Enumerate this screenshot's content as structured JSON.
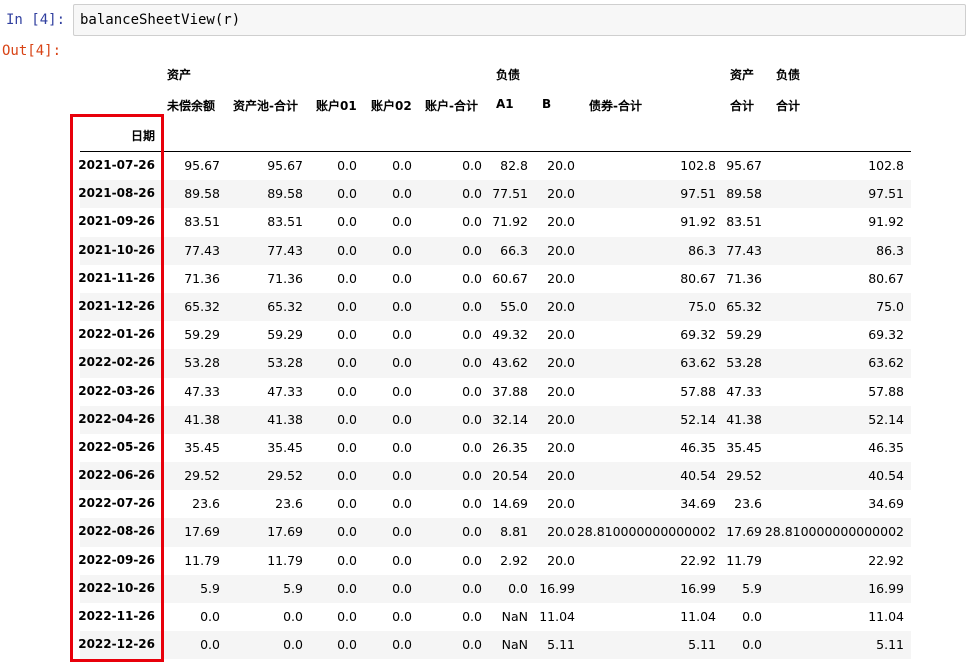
{
  "cell": {
    "in_prompt": "In [4]:",
    "code": "balanceSheetView(r)",
    "out_prompt": "Out[4]:"
  },
  "table": {
    "header_top": [
      "资产",
      "",
      "",
      "",
      "",
      "负债",
      "",
      "",
      "资产",
      "负债"
    ],
    "header_sub": [
      "未偿余额",
      "资产池-合计",
      "账户01",
      "账户02",
      "账户-合计",
      "A1",
      "B",
      "债券-合计",
      "合计",
      "合计"
    ],
    "index_name": "日期",
    "rows": [
      [
        "2021-07-26",
        "95.67",
        "95.67",
        "0.0",
        "0.0",
        "0.0",
        "82.8",
        "20.0",
        "102.8",
        "95.67",
        "102.8"
      ],
      [
        "2021-08-26",
        "89.58",
        "89.58",
        "0.0",
        "0.0",
        "0.0",
        "77.51",
        "20.0",
        "97.51",
        "89.58",
        "97.51"
      ],
      [
        "2021-09-26",
        "83.51",
        "83.51",
        "0.0",
        "0.0",
        "0.0",
        "71.92",
        "20.0",
        "91.92",
        "83.51",
        "91.92"
      ],
      [
        "2021-10-26",
        "77.43",
        "77.43",
        "0.0",
        "0.0",
        "0.0",
        "66.3",
        "20.0",
        "86.3",
        "77.43",
        "86.3"
      ],
      [
        "2021-11-26",
        "71.36",
        "71.36",
        "0.0",
        "0.0",
        "0.0",
        "60.67",
        "20.0",
        "80.67",
        "71.36",
        "80.67"
      ],
      [
        "2021-12-26",
        "65.32",
        "65.32",
        "0.0",
        "0.0",
        "0.0",
        "55.0",
        "20.0",
        "75.0",
        "65.32",
        "75.0"
      ],
      [
        "2022-01-26",
        "59.29",
        "59.29",
        "0.0",
        "0.0",
        "0.0",
        "49.32",
        "20.0",
        "69.32",
        "59.29",
        "69.32"
      ],
      [
        "2022-02-26",
        "53.28",
        "53.28",
        "0.0",
        "0.0",
        "0.0",
        "43.62",
        "20.0",
        "63.62",
        "53.28",
        "63.62"
      ],
      [
        "2022-03-26",
        "47.33",
        "47.33",
        "0.0",
        "0.0",
        "0.0",
        "37.88",
        "20.0",
        "57.88",
        "47.33",
        "57.88"
      ],
      [
        "2022-04-26",
        "41.38",
        "41.38",
        "0.0",
        "0.0",
        "0.0",
        "32.14",
        "20.0",
        "52.14",
        "41.38",
        "52.14"
      ],
      [
        "2022-05-26",
        "35.45",
        "35.45",
        "0.0",
        "0.0",
        "0.0",
        "26.35",
        "20.0",
        "46.35",
        "35.45",
        "46.35"
      ],
      [
        "2022-06-26",
        "29.52",
        "29.52",
        "0.0",
        "0.0",
        "0.0",
        "20.54",
        "20.0",
        "40.54",
        "29.52",
        "40.54"
      ],
      [
        "2022-07-26",
        "23.6",
        "23.6",
        "0.0",
        "0.0",
        "0.0",
        "14.69",
        "20.0",
        "34.69",
        "23.6",
        "34.69"
      ],
      [
        "2022-08-26",
        "17.69",
        "17.69",
        "0.0",
        "0.0",
        "0.0",
        "8.81",
        "20.0",
        "28.810000000000002",
        "17.69",
        "28.810000000000002"
      ],
      [
        "2022-09-26",
        "11.79",
        "11.79",
        "0.0",
        "0.0",
        "0.0",
        "2.92",
        "20.0",
        "22.92",
        "11.79",
        "22.92"
      ],
      [
        "2022-10-26",
        "5.9",
        "5.9",
        "0.0",
        "0.0",
        "0.0",
        "0.0",
        "16.99",
        "16.99",
        "5.9",
        "16.99"
      ],
      [
        "2022-11-26",
        "0.0",
        "0.0",
        "0.0",
        "0.0",
        "0.0",
        "NaN",
        "11.04",
        "11.04",
        "0.0",
        "11.04"
      ],
      [
        "2022-12-26",
        "0.0",
        "0.0",
        "0.0",
        "0.0",
        "0.0",
        "NaN",
        "5.11",
        "5.11",
        "0.0",
        "5.11"
      ]
    ]
  },
  "annotation": {
    "highlight_color": "#e8000b",
    "highlights": "index-column"
  }
}
